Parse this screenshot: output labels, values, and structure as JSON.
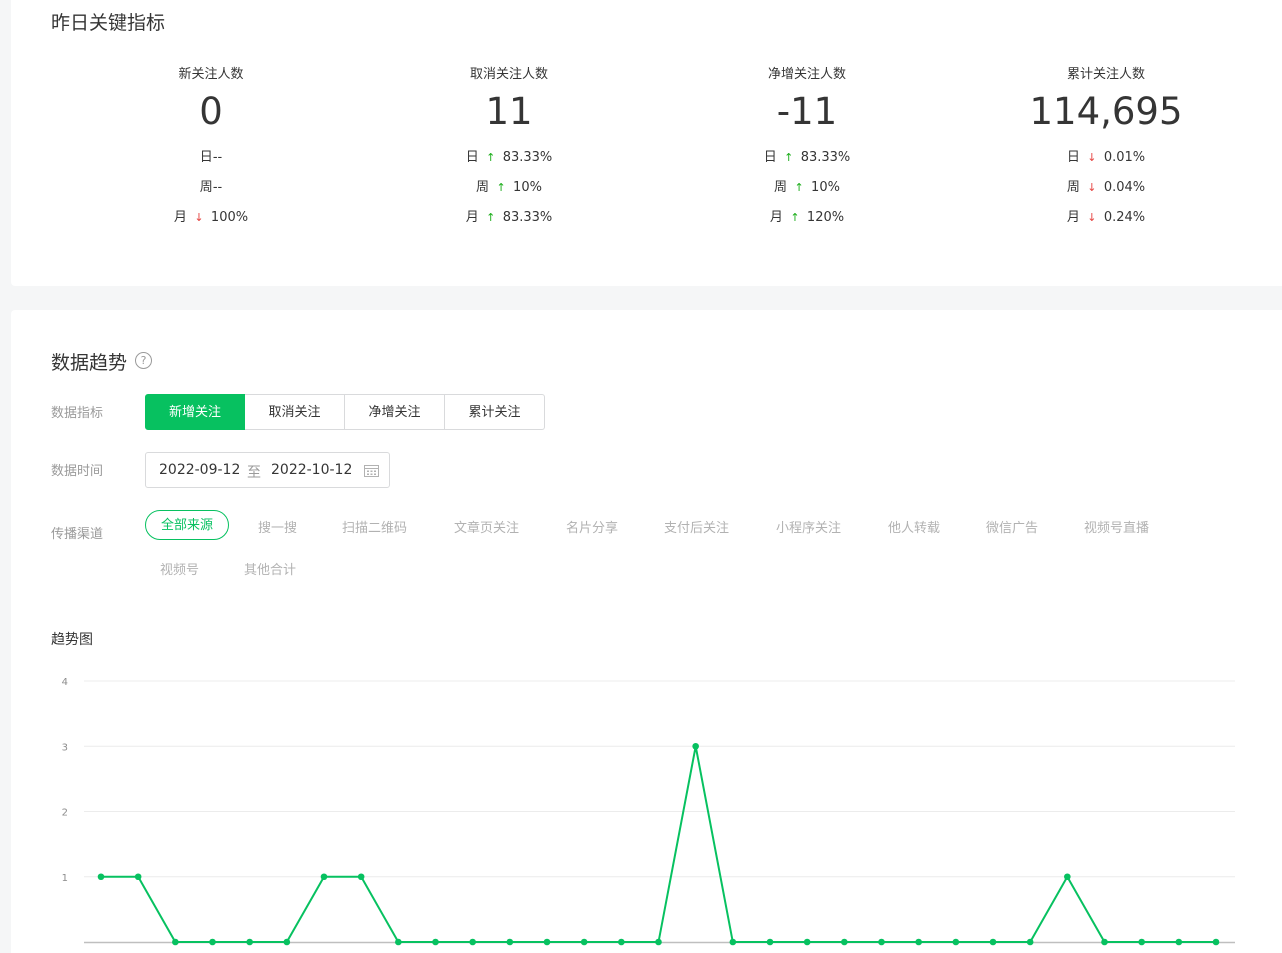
{
  "metrics_section": {
    "title": "昨日关键指标",
    "cards": [
      {
        "label": "新关注人数",
        "value": "0",
        "rows": [
          {
            "period": "日",
            "change": "--",
            "direction": "none"
          },
          {
            "period": "周",
            "change": "--",
            "direction": "none"
          },
          {
            "period": "月",
            "change": "100%",
            "direction": "down"
          }
        ]
      },
      {
        "label": "取消关注人数",
        "value": "11",
        "rows": [
          {
            "period": "日",
            "change": "83.33%",
            "direction": "up"
          },
          {
            "period": "周",
            "change": "10%",
            "direction": "up"
          },
          {
            "period": "月",
            "change": "83.33%",
            "direction": "up"
          }
        ]
      },
      {
        "label": "净增关注人数",
        "value": "-11",
        "rows": [
          {
            "period": "日",
            "change": "83.33%",
            "direction": "up"
          },
          {
            "period": "周",
            "change": "10%",
            "direction": "up"
          },
          {
            "period": "月",
            "change": "120%",
            "direction": "up"
          }
        ]
      },
      {
        "label": "累计关注人数",
        "value": "114,695",
        "rows": [
          {
            "period": "日",
            "change": "0.01%",
            "direction": "down"
          },
          {
            "period": "周",
            "change": "0.04%",
            "direction": "down"
          },
          {
            "period": "月",
            "change": "0.24%",
            "direction": "down"
          }
        ]
      }
    ]
  },
  "trend_section": {
    "title": "数据趋势",
    "help_icon": "question-circle-icon",
    "indicator_label": "数据指标",
    "indicator_tabs": [
      "新增关注",
      "取消关注",
      "净增关注",
      "累计关注"
    ],
    "indicator_active": "新增关注",
    "time_label": "数据时间",
    "date_start": "2022-09-12",
    "date_separator": "至",
    "date_end": "2022-10-12",
    "calendar_icon": "calendar-icon",
    "channel_label": "传播渠道",
    "channels": [
      "全部来源",
      "搜一搜",
      "扫描二维码",
      "文章页关注",
      "名片分享",
      "支付后关注",
      "小程序关注",
      "他人转载",
      "微信广告",
      "视频号直播",
      "视频号",
      "其他合计"
    ],
    "channel_active": "全部来源",
    "chart_title": "趋势图"
  },
  "colors": {
    "accent": "#07c160",
    "up": "#1aad19",
    "down": "#e64340"
  },
  "chart_data": {
    "type": "line",
    "title": "",
    "xlabel": "",
    "ylabel": "",
    "ylim": [
      0,
      4
    ],
    "yticks": [
      "4",
      "3",
      "2",
      "1"
    ],
    "grid": true,
    "series": [
      {
        "values": [
          1,
          1,
          0,
          0,
          0,
          0,
          1,
          1,
          0,
          0,
          0,
          0,
          0,
          0,
          0,
          0,
          3,
          0,
          0,
          0,
          0,
          0,
          0,
          0,
          0,
          0,
          1,
          0,
          0,
          0,
          0
        ]
      }
    ]
  }
}
